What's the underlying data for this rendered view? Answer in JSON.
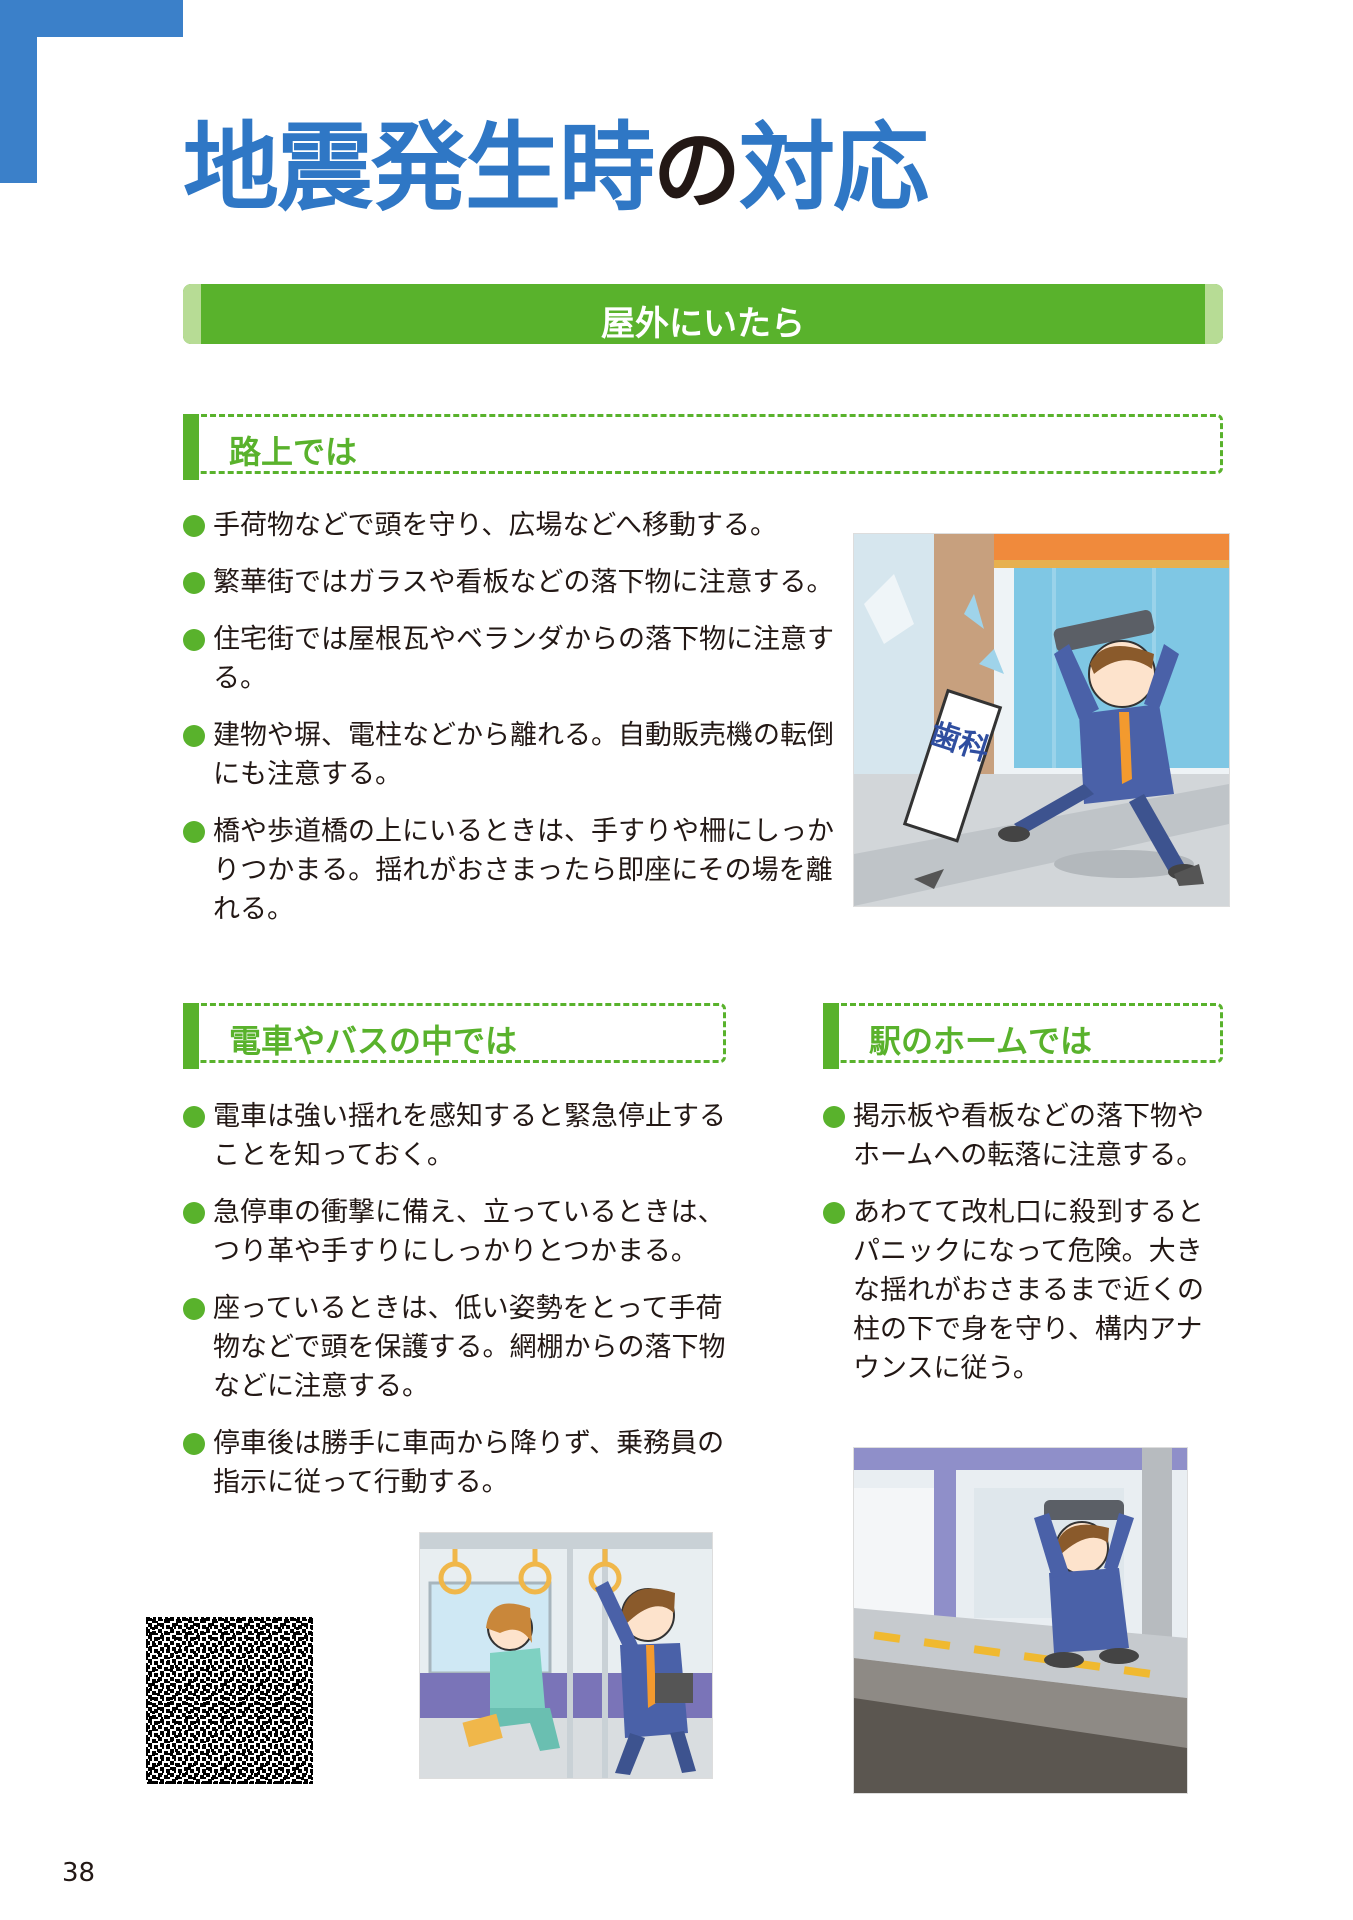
{
  "title": {
    "part1": "地震発生時",
    "part2": "の",
    "part3": "対応"
  },
  "banner": {
    "label": "屋外にいたら"
  },
  "street": {
    "heading": "路上では",
    "items": [
      "手荷物などで頭を守り、広場などへ移動する。",
      "繁華街ではガラスや看板などの落下物に注意する。",
      "住宅街では屋根瓦やベランダからの落下物に注意する。",
      "建物や塀、電柱などから離れる。自動販売機の転倒にも注意する。",
      "橋や歩道橋の上にいるときは、手すりや柵にしっかりつかまる。揺れがおさまったら即座にその場を離れる。"
    ],
    "sign_text": "歯科"
  },
  "train": {
    "heading": "電車やバスの中では",
    "items": [
      "電車は強い揺れを感知すると緊急停止することを知っておく。",
      "急停車の衝撃に備え、立っているときは、つり革や手すりにしっかりとつかまる。",
      "座っているときは、低い姿勢をとって手荷物などで頭を保護する。網棚からの落下物などに注意する。",
      "停車後は勝手に車両から降りず、乗務員の指示に従って行動する。"
    ]
  },
  "station": {
    "heading": "駅のホームでは",
    "items": [
      "掲示板や看板などの落下物やホームへの転落に注意する。",
      "あわてて改札口に殺到するとパニックになって危険。大きな揺れがおさまるまで近くの柱の下で身を守り、構内アナウンスに従う。"
    ]
  },
  "page_number": "38",
  "colors": {
    "blue": "#2f77c5",
    "green": "#59b22c",
    "light_green": "#b7dc95"
  },
  "icons": [
    "bullet-dot-icon",
    "qr-code-icon"
  ]
}
